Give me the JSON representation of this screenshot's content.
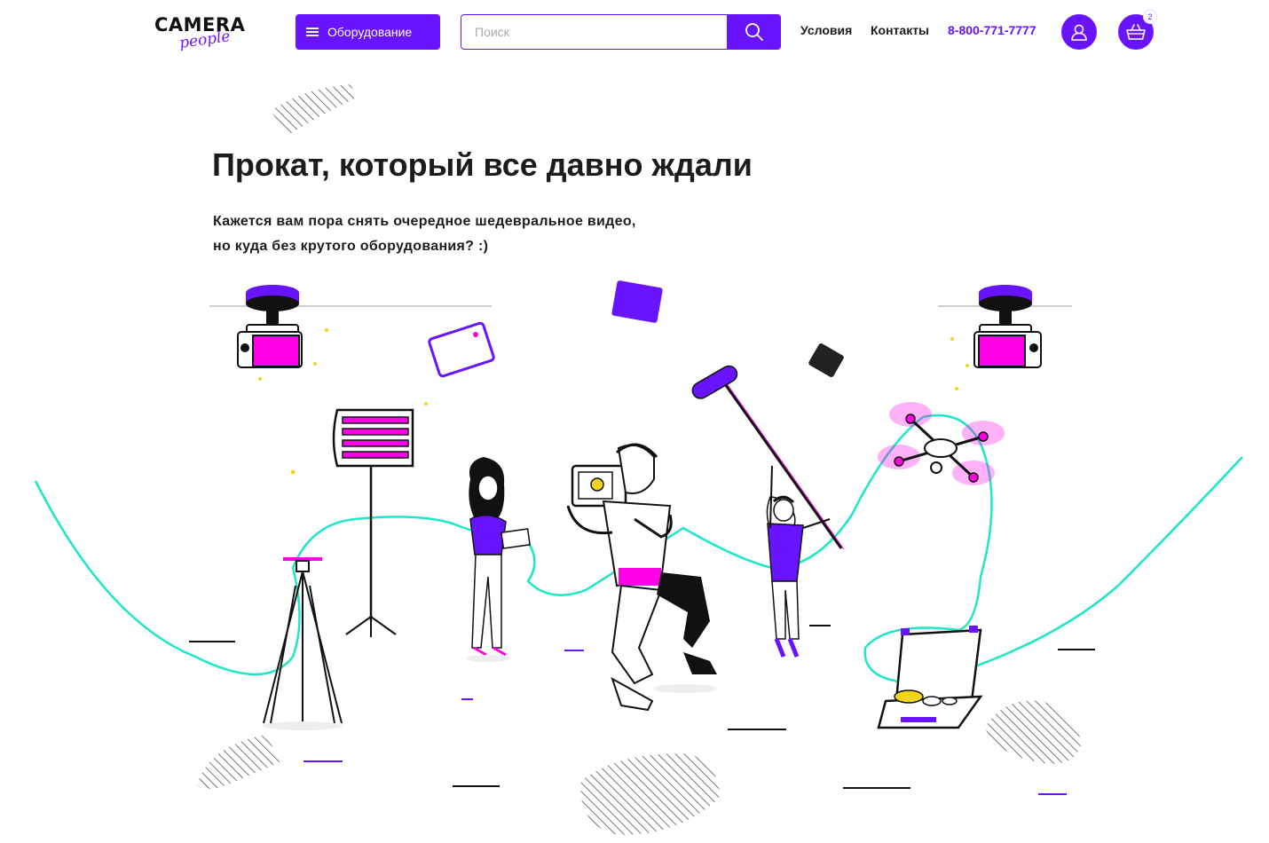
{
  "header": {
    "logo": {
      "main": "CAMERA",
      "sub": "people"
    },
    "equipment_button": {
      "label": "Оборудование"
    },
    "search": {
      "placeholder": "Поиск",
      "value": ""
    },
    "nav": [
      {
        "label": "Условия"
      },
      {
        "label": "Контакты"
      }
    ],
    "phone": "8-800-771-7777",
    "cart": {
      "count": "2"
    }
  },
  "hero": {
    "title": "Прокат, который все давно ждали",
    "subtitle_lines": [
      "Кажется вам пора снять очередное шедевральное видео,",
      "но куда без крутого оборудования? :)"
    ]
  },
  "colors": {
    "accent": "#6814ff",
    "magenta": "#ff00e6",
    "cable": "#1ee6c8",
    "ink": "#1c1c1c"
  },
  "icons": [
    "menu-icon",
    "search-icon",
    "user-icon",
    "basket-icon"
  ]
}
